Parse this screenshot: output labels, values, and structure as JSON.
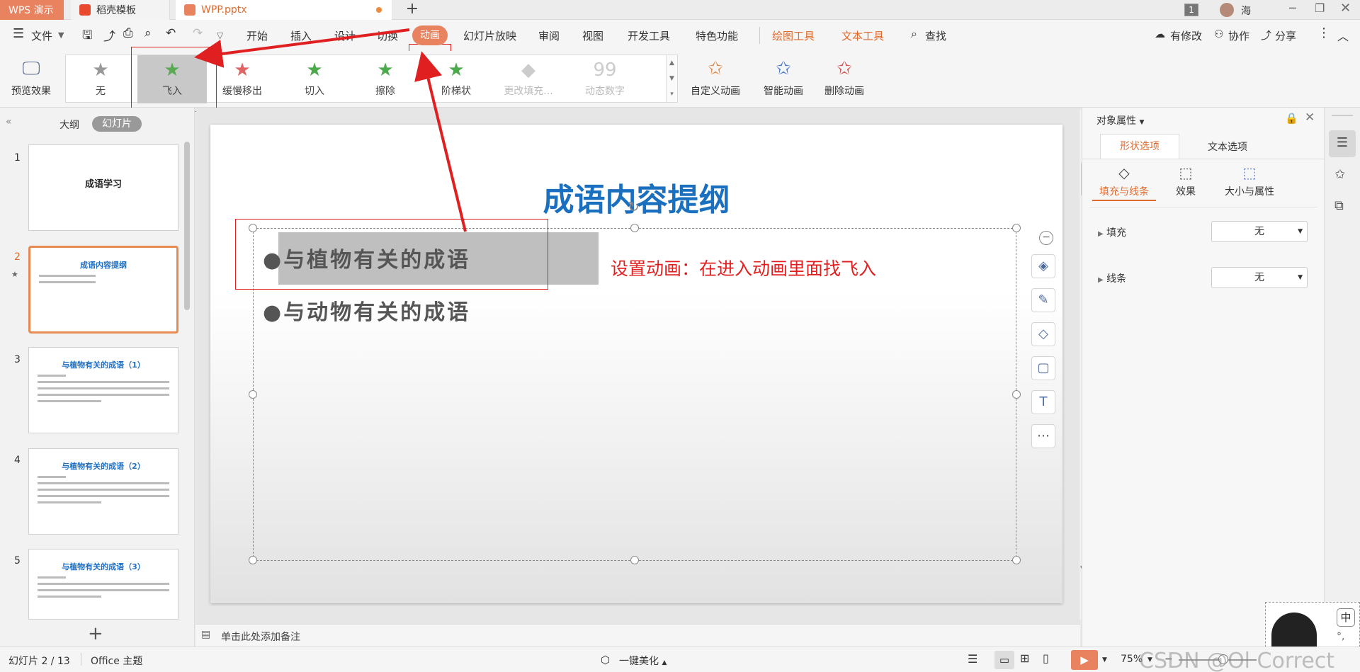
{
  "tabs": {
    "wps": "WPS 演示",
    "template": "稻壳模板",
    "file": "WPP.pptx",
    "add": "+"
  },
  "window": {
    "page_badge": "1",
    "user": "海"
  },
  "menu": {
    "file": "文件",
    "items": [
      "开始",
      "插入",
      "设计",
      "切换",
      "动画",
      "幻灯片放映",
      "审阅",
      "视图",
      "开发工具",
      "特色功能"
    ],
    "active": "动画",
    "drawing_tools": "绘图工具",
    "text_tools": "文本工具",
    "search": "查找",
    "modified": "有修改",
    "collab": "协作",
    "share": "分享"
  },
  "ribbon": {
    "preview": "预览效果",
    "gallery": [
      "无",
      "飞入",
      "缓慢移出",
      "切入",
      "擦除",
      "阶梯状",
      "更改填充...",
      "动态数字"
    ],
    "selected": "飞入",
    "custom": "自定义动画",
    "smart": "智能动画",
    "delete": "删除动画"
  },
  "leftpanel": {
    "outline_tab": "大纲",
    "slides_tab": "幻灯片",
    "slides": [
      {
        "num": "1",
        "title": "成语学习"
      },
      {
        "num": "2",
        "title": "成语内容提纲"
      },
      {
        "num": "3",
        "title": "与植物有关的成语（1）"
      },
      {
        "num": "4",
        "title": "与植物有关的成语（2）"
      },
      {
        "num": "5",
        "title": "与植物有关的成语（3）"
      }
    ],
    "add": "+"
  },
  "slide": {
    "title": "成语内容提纲",
    "bullets": [
      "与植物有关的成语",
      "与动物有关的成语"
    ],
    "annotation": "设置动画：在进入动画里面找飞入"
  },
  "notes": "单击此处添加备注",
  "rightpanel": {
    "title": "对象属性",
    "tabs": [
      "形状选项",
      "文本选项"
    ],
    "subtabs": [
      "填充与线条",
      "效果",
      "大小与属性"
    ],
    "fill_label": "填充",
    "fill_value": "无",
    "line_label": "线条",
    "line_value": "无"
  },
  "status": {
    "slide": "幻灯片 2 / 13",
    "theme": "Office 主题",
    "beautify": "一键美化",
    "zoom": "75%",
    "watermark": "CSDN @Ol Correct"
  },
  "colors": {
    "accent": "#e9825e",
    "title_blue": "#1a6fbf",
    "annotation_red": "#e02020",
    "arrow_red": "#e02020"
  }
}
